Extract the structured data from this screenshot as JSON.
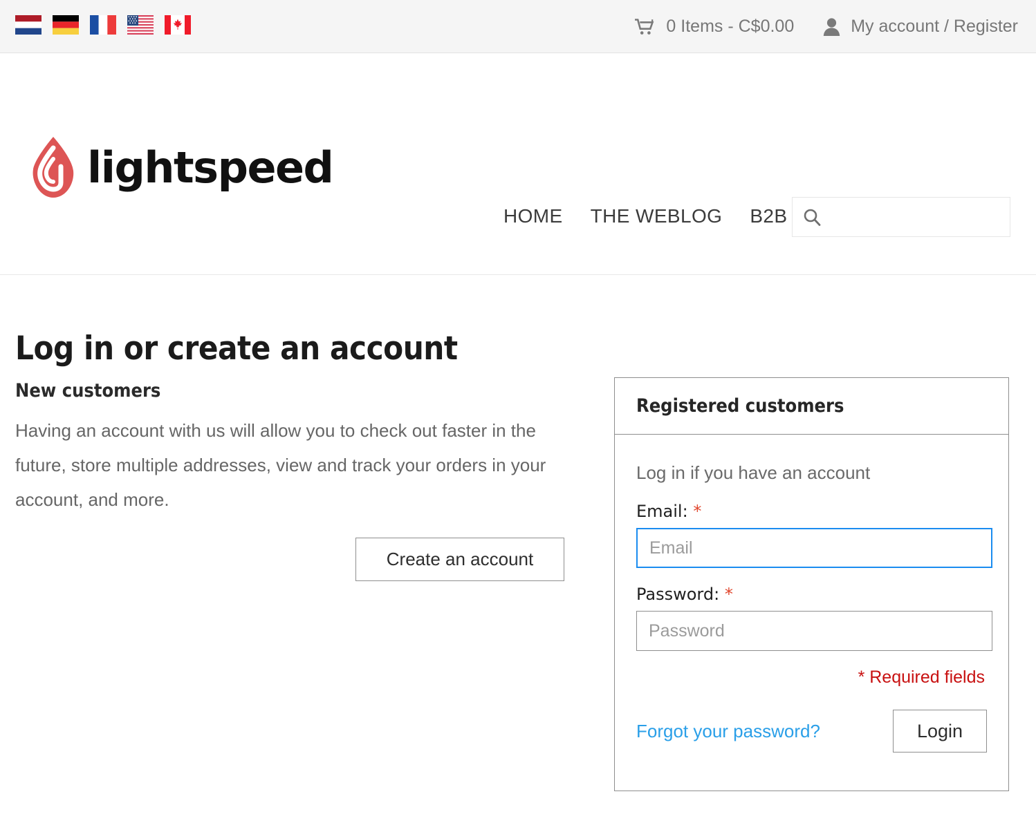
{
  "topbar": {
    "languages": [
      {
        "name": "netherlands-flag",
        "label": "Nederlands"
      },
      {
        "name": "germany-flag",
        "label": "Deutsch"
      },
      {
        "name": "france-flag",
        "label": "Français"
      },
      {
        "name": "usa-flag",
        "label": "English (US)"
      },
      {
        "name": "canada-flag",
        "label": "English (CA)"
      }
    ],
    "cart_icon": "cart-icon",
    "cart_text": "0 Items - C$0.00",
    "account_icon": "user-icon",
    "account_text": "My account / Register"
  },
  "header": {
    "logo_text": "lightspeed",
    "logo_icon": "lightspeed-flame-logo",
    "nav": [
      {
        "label": "HOME"
      },
      {
        "label": "THE WEBLOG"
      },
      {
        "label": "B2B"
      }
    ],
    "search": {
      "icon": "search-icon",
      "value": "",
      "placeholder": ""
    }
  },
  "main": {
    "page_title": "Log in or create an account",
    "new_customers": {
      "heading": "New customers",
      "body": "Having an account with us will allow you to check out faster in the future, store multiple addresses, view and track your orders in your account, and more.",
      "button_label": "Create an account"
    },
    "registered_customers": {
      "heading": "Registered customers",
      "subtitle": "Log in if you have an account",
      "email_label": "Email:",
      "email_required_mark": "*",
      "email_value": "",
      "email_placeholder": "Email",
      "password_label": "Password:",
      "password_required_mark": "*",
      "password_value": "",
      "password_placeholder": "Password",
      "required_note": "* Required fields",
      "forgot_link": "Forgot your password?",
      "login_button": "Login"
    }
  },
  "colors": {
    "brand_red": "#e05353",
    "link_blue": "#2a9fe8",
    "focus_blue": "#1a8cf0",
    "required_red": "#c81111",
    "asterisk_red": "#e0452c",
    "topbar_bg": "#f5f5f5"
  }
}
